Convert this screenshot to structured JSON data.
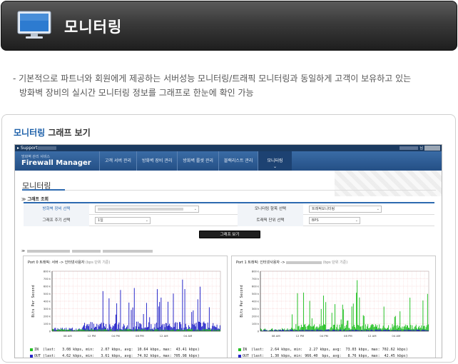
{
  "header": {
    "title": "모니터링",
    "icon": "monitor-icon"
  },
  "description": {
    "line1": "- 기본적으로 파트너와 회원에게 제공하는 서버성능 모니터링/트래픽 모니터링과 동일하게 고객이 보유하고 있는",
    "line2": "방화벽 장비의 실시간 모니터링 정보를 그래프로 한눈에 확인 가능"
  },
  "card": {
    "title_highlight": "모니터링",
    "title_rest": " 그래프 보기"
  },
  "app": {
    "topbar": {
      "support": "▸ Support",
      "user_suffix": "님"
    },
    "brand_small": "방화벽 관리 서비스",
    "brand": "Firewall Manager",
    "menu": [
      "고객 서버 관리",
      "방화벽 장비 관리",
      "방화벽 룰셋 관리",
      "블랙리스트 관리",
      "모니터링"
    ],
    "page_title": "모니터링",
    "section_title": "그래프 조회",
    "form": {
      "device_label": "방화벽 장비 선택",
      "item_label": "모니터링 항목 선택",
      "item_value": "트래픽모니터링",
      "cycle_label": "그래프 주기 선택",
      "cycle_value": "1일",
      "unit_label": "트래픽 단위 선택",
      "unit_value": "BPS",
      "button": "그래프 보기"
    },
    "section_marker": "≫",
    "graphs": [
      {
        "title": "Port 0 트래픽: 서버 -> 인터넷사용자",
        "note": "(bps 단위 기준)",
        "ylabel": "Bits Per Second",
        "in_line": "IN  (last:   3.08 kbps, min:   2.07 kbps, avg:  10.64 kbps, max:  43.41 kbps)",
        "out_line": "OUT (last:   4.62 kbps, min:   3.61 kbps, avg:  74.92 kbps, max: 705.98 kbps)",
        "main_color": "#2424c8"
      },
      {
        "title": "Port 1 트래픽: 인터넷사용자 ->",
        "note": "(bps 단위 기준)",
        "ylabel": "Bits Per Second",
        "in_line": "IN  (last:   2.64 kbps, min:   2.27 kbps, avg:  73.03 kbps, max: 702.62 kbps)",
        "out_line": "OUT (last:   1.30 kbps, min: 966.40  bps, avg:   8.76 kbps, max:  42.45 kbps)",
        "main_color": "#22c022"
      }
    ],
    "legend_colors": {
      "in": "#22c022",
      "out": "#2424c8"
    },
    "yticks": [
      "800 k",
      "700 k",
      "600 k",
      "500 k",
      "400 k",
      "300 k",
      "200 k",
      "100 k",
      "0"
    ],
    "xticks": [
      "08 AM",
      "12 PM",
      "04 PM",
      "08 PM",
      "12 AM",
      "04 AM"
    ]
  }
}
